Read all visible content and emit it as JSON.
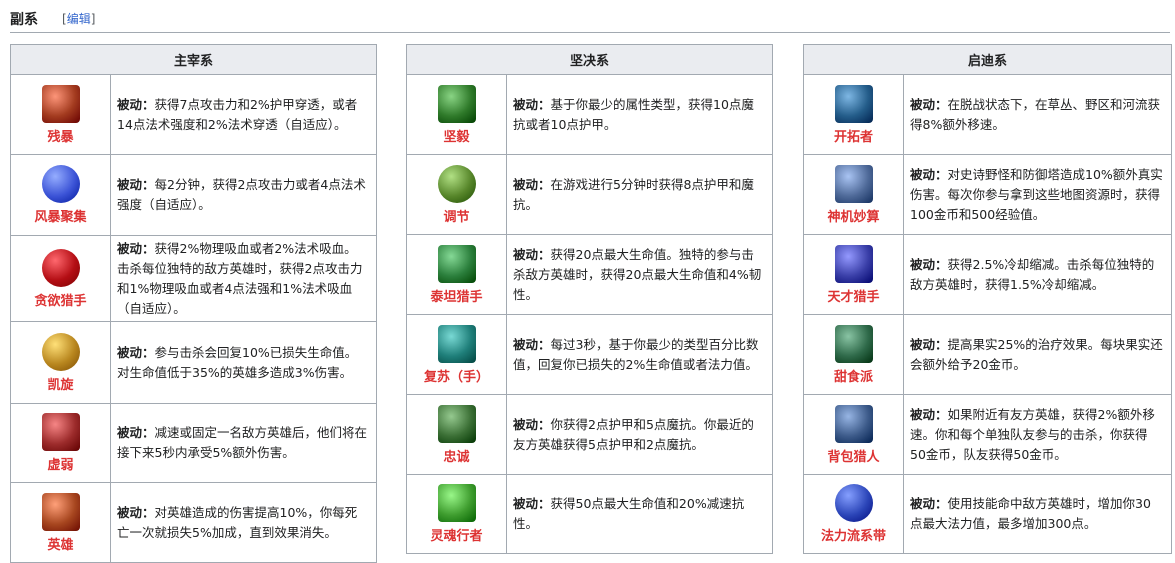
{
  "section": {
    "title": "副系",
    "edit_open": "[",
    "edit_label": "编辑",
    "edit_close": "]"
  },
  "passive_label": "被动：",
  "columns": [
    {
      "header": "主宰系",
      "runes": [
        {
          "name": "残暴",
          "icon": "brutal-icon",
          "color": "#a33b1f",
          "desc": "获得7点攻击力和2%护甲穿透，或者14点法术强度和2%法术穿透（自适应）。"
        },
        {
          "name": "风暴聚集",
          "icon": "storm-icon",
          "color": "#3b53d6",
          "desc": "每2分钟，获得2点攻击力或者4点法术强度（自适应）。"
        },
        {
          "name": "贪欲猎手",
          "icon": "greed-icon",
          "color": "#b40e14",
          "desc": "获得2%物理吸血或者2%法术吸血。击杀每位独特的敌方英雄时，获得2点攻击力和1%物理吸血或者4点法强和1%法术吸血（自适应）。"
        },
        {
          "name": "凯旋",
          "icon": "triumph-icon",
          "color": "#b8861e",
          "desc": "参与击杀会回复10%已损失生命值。对生命值低于35%的英雄多造成3%伤害。"
        },
        {
          "name": "虚弱",
          "icon": "weakness-icon",
          "color": "#9c2b2b",
          "desc": "减速或固定一名敌方英雄后，他们将在接下来5秒内承受5%额外伤害。"
        },
        {
          "name": "英雄",
          "icon": "hero-icon",
          "color": "#a7461f",
          "desc": "对英雄造成的伤害提高10%，你每死亡一次就损失5%加成，直到效果消失。"
        }
      ]
    },
    {
      "header": "坚决系",
      "runes": [
        {
          "name": "坚毅",
          "icon": "tenacity-icon",
          "color": "#2f7a2a",
          "desc": "基于你最少的属性类型，获得10点魔抗或者10点护甲。"
        },
        {
          "name": "调节",
          "icon": "conditioning-icon",
          "color": "#57862a",
          "desc": "在游戏进行5分钟时获得8点护甲和魔抗。"
        },
        {
          "name": "泰坦猎手",
          "icon": "titan-icon",
          "color": "#2b7f3c",
          "desc": "获得20点最大生命值。独特的参与击杀敌方英雄时，获得20点最大生命值和4%韧性。"
        },
        {
          "name": "复苏（手）",
          "icon": "revitalize-icon",
          "color": "#1f7f7a",
          "desc": "每过3秒，基于你最少的类型百分比数值，回复你已损失的2%生命值或者法力值。"
        },
        {
          "name": "忠诚",
          "icon": "loyalty-icon",
          "color": "#3b6f35",
          "desc": "你获得2点护甲和5点魔抗。你最近的友方英雄获得5点护甲和2点魔抗。"
        },
        {
          "name": "灵魂行者",
          "icon": "soulwalker-icon",
          "color": "#3f9d2f",
          "desc": "获得50点最大生命值和20%减速抗性。"
        }
      ]
    },
    {
      "header": "启迪系",
      "runes": [
        {
          "name": "开拓者",
          "icon": "pioneer-icon",
          "color": "#245d8a",
          "desc": "在脱战状态下，在草丛、野区和河流获得8%额外移速。"
        },
        {
          "name": "神机妙算",
          "icon": "tower-icon",
          "color": "#4f6a99",
          "desc": "对史诗野怪和防御塔造成10%额外真实伤害。每次你参与拿到这些地图资源时，获得100金币和500经验值。"
        },
        {
          "name": "天才猎手",
          "icon": "owl-icon",
          "color": "#3a3fa8",
          "desc": "获得2.5%冷却缩减。击杀每位独特的敌方英雄时，获得1.5%冷却缩减。"
        },
        {
          "name": "甜食派",
          "icon": "sweet-icon",
          "color": "#2f6a4a",
          "desc": "提高果实25%的治疗效果。每块果实还会额外给予20金币。"
        },
        {
          "name": "背包猎人",
          "icon": "packhunter-icon",
          "color": "#3d5b8a",
          "desc": "如果附近有友方英雄，获得2%额外移速。你和每个单独队友参与的击杀，你获得50金币，队友获得50金币。"
        },
        {
          "name": "法力流系带",
          "icon": "manaband-icon",
          "color": "#2b45b8",
          "desc": "使用技能命中敌方英雄时，增加你30点最大法力值，最多增加300点。"
        }
      ]
    }
  ]
}
